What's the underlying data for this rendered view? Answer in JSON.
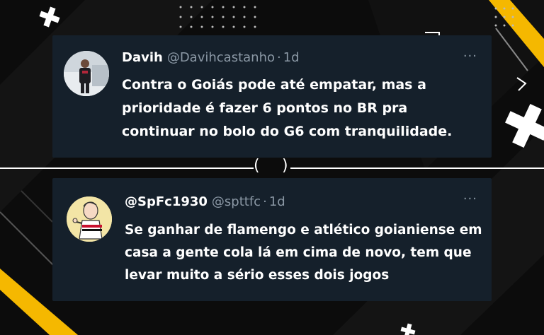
{
  "colors": {
    "background": "#0c0c0c",
    "card": "#15202b",
    "text_primary": "#ffffff",
    "text_secondary": "#8b98a5",
    "accent_yellow": "#f5b800"
  },
  "tweets": [
    {
      "name": "Davih",
      "handle": "@Davihcastanho",
      "separator": "·",
      "time": "1d",
      "more": "···",
      "text": "Contra o Goiás pode até empatar, mas a prioridade é fazer 6 pontos no BR pra continuar no bolo do G6 com tranquilidade."
    },
    {
      "name": "@SpFc1930",
      "handle": "@spttfc",
      "separator": "·",
      "time": "1d",
      "more": "···",
      "text": "Se ganhar de flamengo e atlético goianiense em casa a gente cola lá em cima de novo, tem que levar muito a sério esses dois jogos"
    }
  ],
  "divider": {
    "left": "(",
    "right": ")"
  }
}
